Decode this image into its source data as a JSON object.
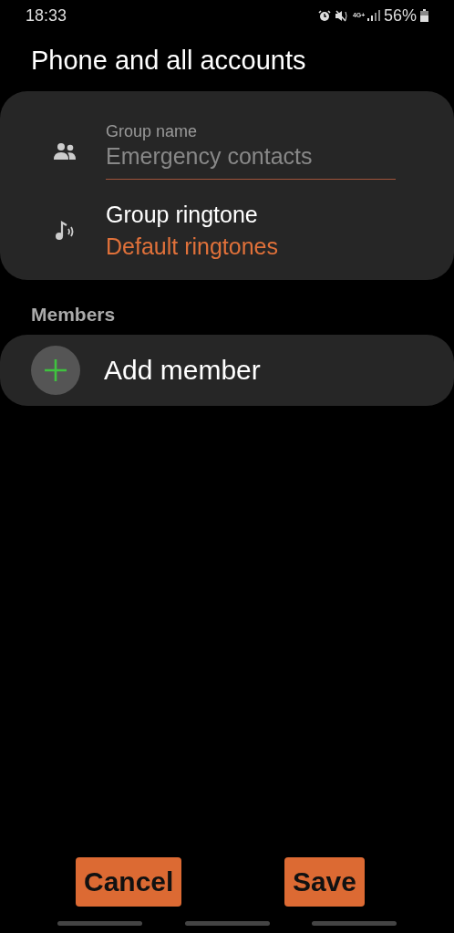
{
  "status_bar": {
    "time": "18:33",
    "network": "4G+",
    "battery": "56%"
  },
  "title": "Phone and all accounts",
  "group_card": {
    "name_field": {
      "label": "Group name",
      "placeholder": "Emergency contacts"
    },
    "ringtone": {
      "title": "Group ringtone",
      "value": "Default ringtones"
    }
  },
  "members": {
    "heading": "Members",
    "add_label": "Add member"
  },
  "buttons": [
    {
      "label": "Cancel"
    },
    {
      "label": "Save"
    }
  ]
}
